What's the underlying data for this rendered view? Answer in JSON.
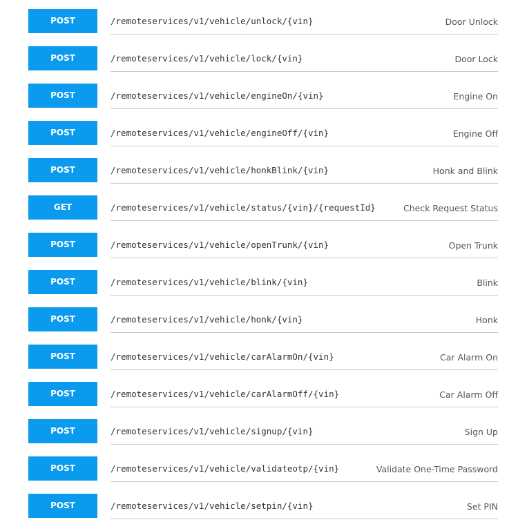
{
  "theme": {
    "method_color": "#0a9bef"
  },
  "endpoints": [
    {
      "method": "POST",
      "path": "/remoteservices/v1/vehicle/unlock/{vin}",
      "description": "Door Unlock"
    },
    {
      "method": "POST",
      "path": "/remoteservices/v1/vehicle/lock/{vin}",
      "description": "Door Lock"
    },
    {
      "method": "POST",
      "path": "/remoteservices/v1/vehicle/engineOn/{vin}",
      "description": "Engine On"
    },
    {
      "method": "POST",
      "path": "/remoteservices/v1/vehicle/engineOff/{vin}",
      "description": "Engine Off"
    },
    {
      "method": "POST",
      "path": "/remoteservices/v1/vehicle/honkBlink/{vin}",
      "description": "Honk and Blink"
    },
    {
      "method": "GET",
      "path": "/remoteservices/v1/vehicle/status/{vin}/{requestId}",
      "description": "Check Request Status"
    },
    {
      "method": "POST",
      "path": "/remoteservices/v1/vehicle/openTrunk/{vin}",
      "description": "Open Trunk"
    },
    {
      "method": "POST",
      "path": "/remoteservices/v1/vehicle/blink/{vin}",
      "description": "Blink"
    },
    {
      "method": "POST",
      "path": "/remoteservices/v1/vehicle/honk/{vin}",
      "description": "Honk"
    },
    {
      "method": "POST",
      "path": "/remoteservices/v1/vehicle/carAlarmOn/{vin}",
      "description": "Car Alarm On"
    },
    {
      "method": "POST",
      "path": "/remoteservices/v1/vehicle/carAlarmOff/{vin}",
      "description": "Car Alarm Off"
    },
    {
      "method": "POST",
      "path": "/remoteservices/v1/vehicle/signup/{vin}",
      "description": "Sign Up"
    },
    {
      "method": "POST",
      "path": "/remoteservices/v1/vehicle/validateotp/{vin}",
      "description": "Validate One-Time Password"
    },
    {
      "method": "POST",
      "path": "/remoteservices/v1/vehicle/setpin/{vin}",
      "description": "Set PIN"
    }
  ]
}
